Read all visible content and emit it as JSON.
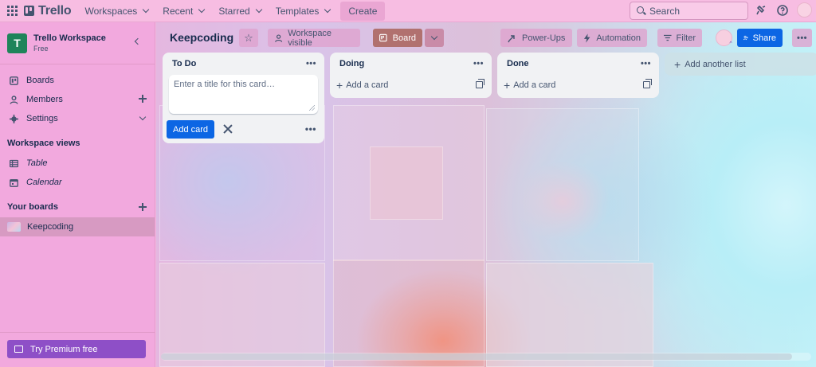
{
  "topbar": {
    "logo": "Trello",
    "nav": [
      "Workspaces",
      "Recent",
      "Starred",
      "Templates"
    ],
    "create": "Create",
    "search_placeholder": "Search"
  },
  "sidebar": {
    "workspace_initial": "T",
    "workspace_name": "Trello Workspace",
    "workspace_plan": "Free",
    "items": [
      {
        "label": "Boards",
        "icon": "boards-icon"
      },
      {
        "label": "Members",
        "icon": "members-icon"
      },
      {
        "label": "Settings",
        "icon": "gear-icon"
      }
    ],
    "views_heading": "Workspace views",
    "views": [
      {
        "label": "Table",
        "icon": "table-icon"
      },
      {
        "label": "Calendar",
        "icon": "calendar-icon"
      }
    ],
    "boards_heading": "Your boards",
    "boards": [
      "Keepcoding"
    ],
    "premium": "Try Premium free"
  },
  "board": {
    "title": "Keepcoding",
    "visibility": "Workspace visible",
    "view": "Board",
    "powerups": "Power-Ups",
    "automation": "Automation",
    "filter": "Filter",
    "share": "Share",
    "add_list": "Add another list"
  },
  "lists": [
    {
      "title": "To Do",
      "placeholder": "Enter a title for this card…",
      "add_button": "Add card"
    },
    {
      "title": "Doing",
      "add_card": "Add a card"
    },
    {
      "title": "Done",
      "add_card": "Add a card"
    }
  ],
  "colors": {
    "brand": "#0c66e4",
    "workspace_logo": "#1f845a",
    "premium": "#8e4fc7"
  }
}
